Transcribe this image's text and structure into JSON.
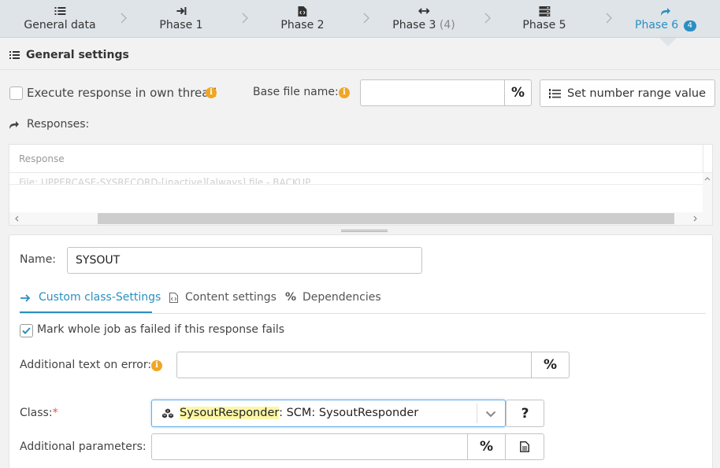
{
  "wizard": {
    "steps": [
      {
        "label": "General data",
        "icon": "list-icon"
      },
      {
        "label": "Phase 1",
        "icon": "arrow-to-line-icon"
      },
      {
        "label": "Phase 2",
        "icon": "file-code-icon"
      },
      {
        "label": "Phase 3",
        "count": "(4)",
        "icon": "arrows-horizontal-icon"
      },
      {
        "label": "Phase 5",
        "icon": "server-icon"
      },
      {
        "label": "Phase 6",
        "badge": "4",
        "icon": "share-arrow-icon",
        "active": true
      }
    ],
    "active_color": "#2a8fc1"
  },
  "general": {
    "title": "General settings",
    "own_thread_label": "Execute response in own thread",
    "own_thread_checked": false,
    "base_file_label": "Base file name:",
    "base_file_value": "",
    "percent_symbol": "%",
    "number_range_button": "Set number range value"
  },
  "responses": {
    "title": "Responses:",
    "column_header": "Response",
    "rows": [
      "File: UPPERCASE-SYSRECORD-[inactive][always] file - BACKUP"
    ]
  },
  "detail": {
    "name_label": "Name:",
    "name_value": "SYSOUT",
    "tabs": [
      {
        "label_a": "Custom class",
        "label_b": "-Settings",
        "icon": "arrow-right-icon",
        "active": true
      },
      {
        "label": "Content settings",
        "icon": "file-code-icon"
      },
      {
        "label": "Dependencies",
        "icon": "percent-icon"
      }
    ],
    "mark_failed_label": "Mark whole job as failed if this response fails",
    "mark_failed_checked": true,
    "additional_text_label": "Additional text on error:",
    "additional_text_value": "",
    "class_label": "Class:",
    "required_mark": "*",
    "class_highlight": "SysoutResponder",
    "class_rest": ": SCM: SysoutResponder",
    "help_symbol": "?",
    "additional_params_label": "Additional parameters:",
    "additional_params_value": ""
  },
  "colors": {
    "accent": "#2a8fc1",
    "info": "#f0a625",
    "highlight": "#fbf7a6",
    "required": "#d9534f"
  }
}
